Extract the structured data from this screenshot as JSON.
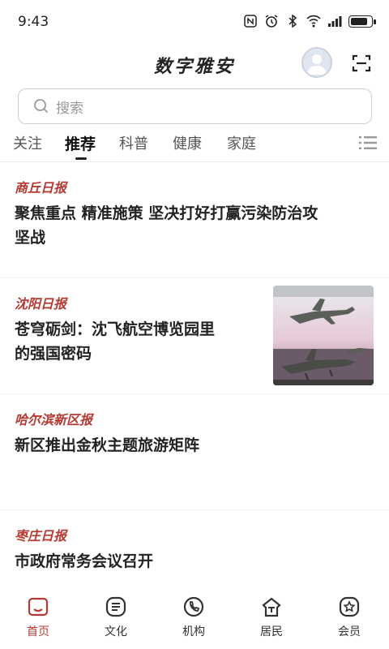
{
  "status_bar": {
    "time": "9:43",
    "battery_level": 0.85
  },
  "header": {
    "title": "数字雅安"
  },
  "search": {
    "placeholder": "搜索"
  },
  "tabs": [
    {
      "label": "关注"
    },
    {
      "label": "推荐"
    },
    {
      "label": "科普"
    },
    {
      "label": "健康"
    },
    {
      "label": "家庭"
    }
  ],
  "active_tab": "推荐",
  "feed": [
    {
      "source": "商丘日报",
      "title_lines": [
        "聚焦重点 精准施策 坚决打好打赢污染防治攻",
        "坚战"
      ]
    },
    {
      "source": "沈阳日报",
      "title_lines": [
        "苍穹砺剑：沈飞航空博览园里",
        "的强国密码"
      ],
      "thumbnail": "fighter-jet-photo"
    },
    {
      "source": "哈尔滨新区报",
      "title_lines": [
        "新区推出金秋主题旅游矩阵"
      ]
    },
    {
      "source": "枣庄日报",
      "title_lines": [
        "市政府常务会议召开"
      ]
    }
  ],
  "bottom_nav": [
    {
      "label": "首页",
      "icon": "home-icon"
    },
    {
      "label": "文化",
      "icon": "culture-icon"
    },
    {
      "label": "机构",
      "icon": "phone-icon"
    },
    {
      "label": "居民",
      "icon": "residents-icon"
    },
    {
      "label": "会员",
      "icon": "member-icon"
    }
  ],
  "colors": {
    "accent": "#b43a32",
    "text": "#222222",
    "muted": "#999999"
  }
}
